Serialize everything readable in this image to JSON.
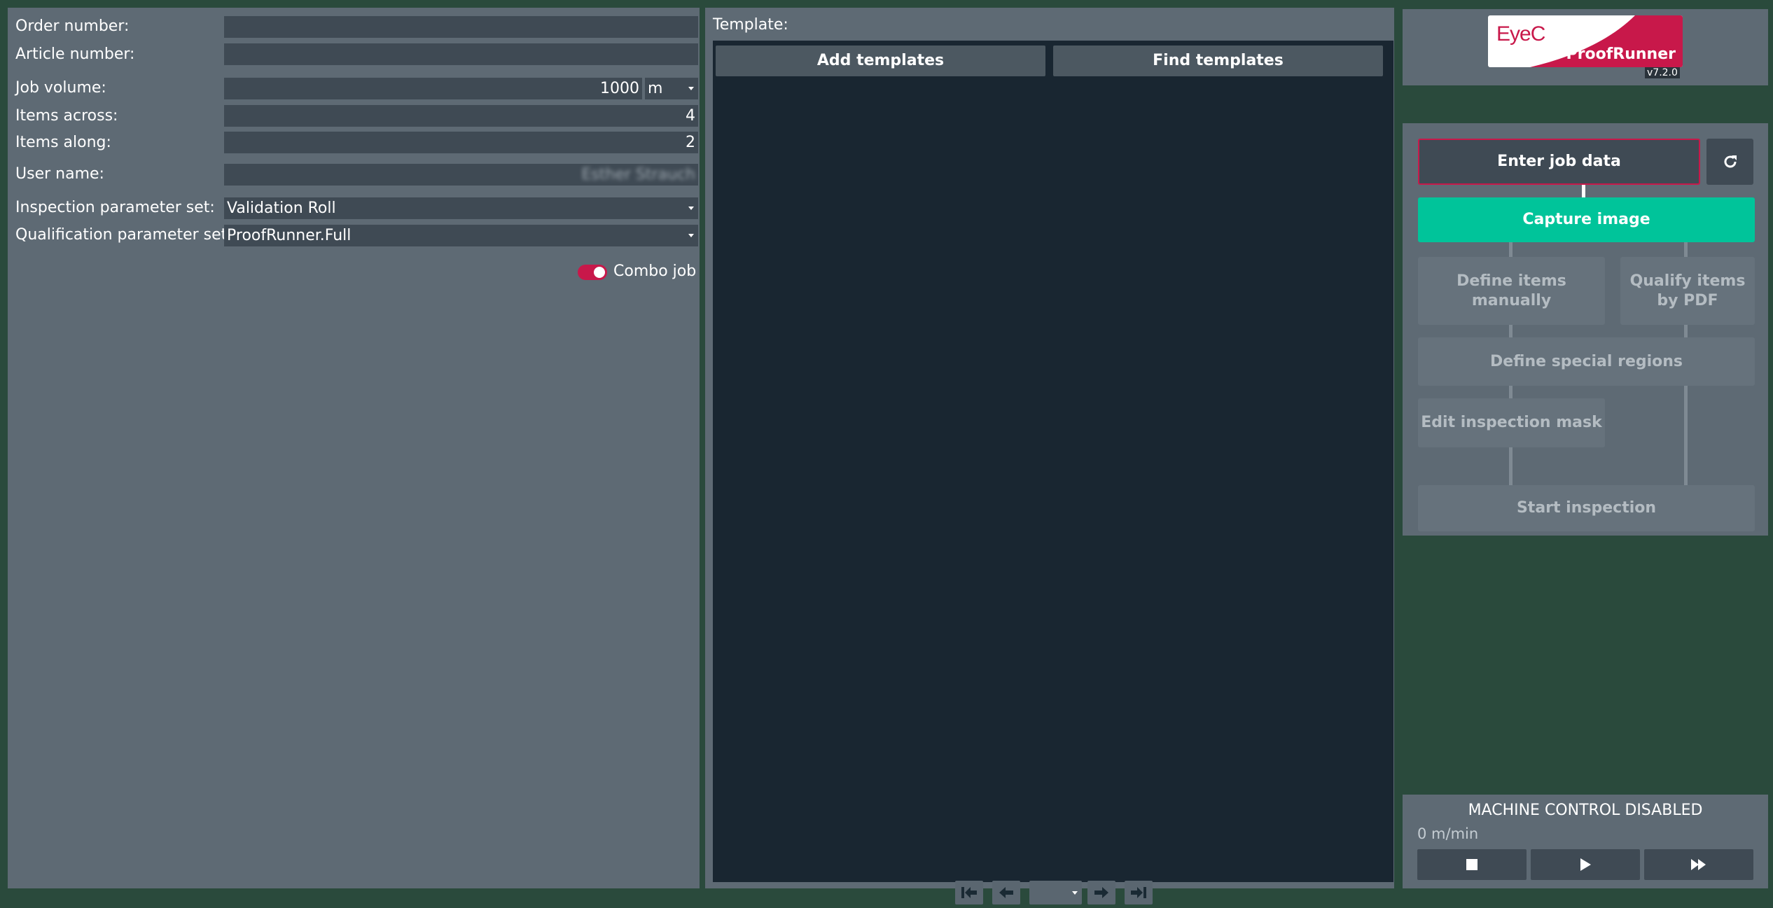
{
  "job_form": {
    "order_number": {
      "label": "Order number:",
      "value": ""
    },
    "article_number": {
      "label": "Article number:",
      "value": ""
    },
    "job_volume": {
      "label": "Job volume:",
      "value": "1000",
      "unit": "m"
    },
    "items_across": {
      "label": "Items across:",
      "value": "4"
    },
    "items_along": {
      "label": "Items along:",
      "value": "2"
    },
    "user_name": {
      "label": "User name:",
      "value": "Esther Strauch"
    },
    "inspection_param_set": {
      "label": "Inspection parameter set:",
      "value": "Validation Roll"
    },
    "qualification_param_set": {
      "label": "Qualification parameter set:",
      "value": "ProofRunner.Full"
    },
    "combo_job": {
      "label": "Combo job",
      "enabled": true
    }
  },
  "template_panel": {
    "label": "Template:",
    "add_button": "Add templates",
    "find_button": "Find templates",
    "page_value": ""
  },
  "logo": {
    "brand": "EyeC",
    "product": "ProofRunner",
    "version": "v7.2.0"
  },
  "workflow": {
    "enter_job_data": "Enter job data",
    "capture_image": "Capture image",
    "define_items_manually": "Define items manually",
    "qualify_items_by_pdf": "Qualify items by PDF",
    "define_special_regions": "Define special regions",
    "edit_inspection_mask": "Edit inspection mask",
    "start_inspection": "Start inspection"
  },
  "machine": {
    "status": "MACHINE CONTROL DISABLED",
    "speed": "0 m/min"
  },
  "colors": {
    "accent": "#c8184a",
    "active_step": "#00c49a",
    "panel": "#5e6a74",
    "dark": "#192631"
  }
}
